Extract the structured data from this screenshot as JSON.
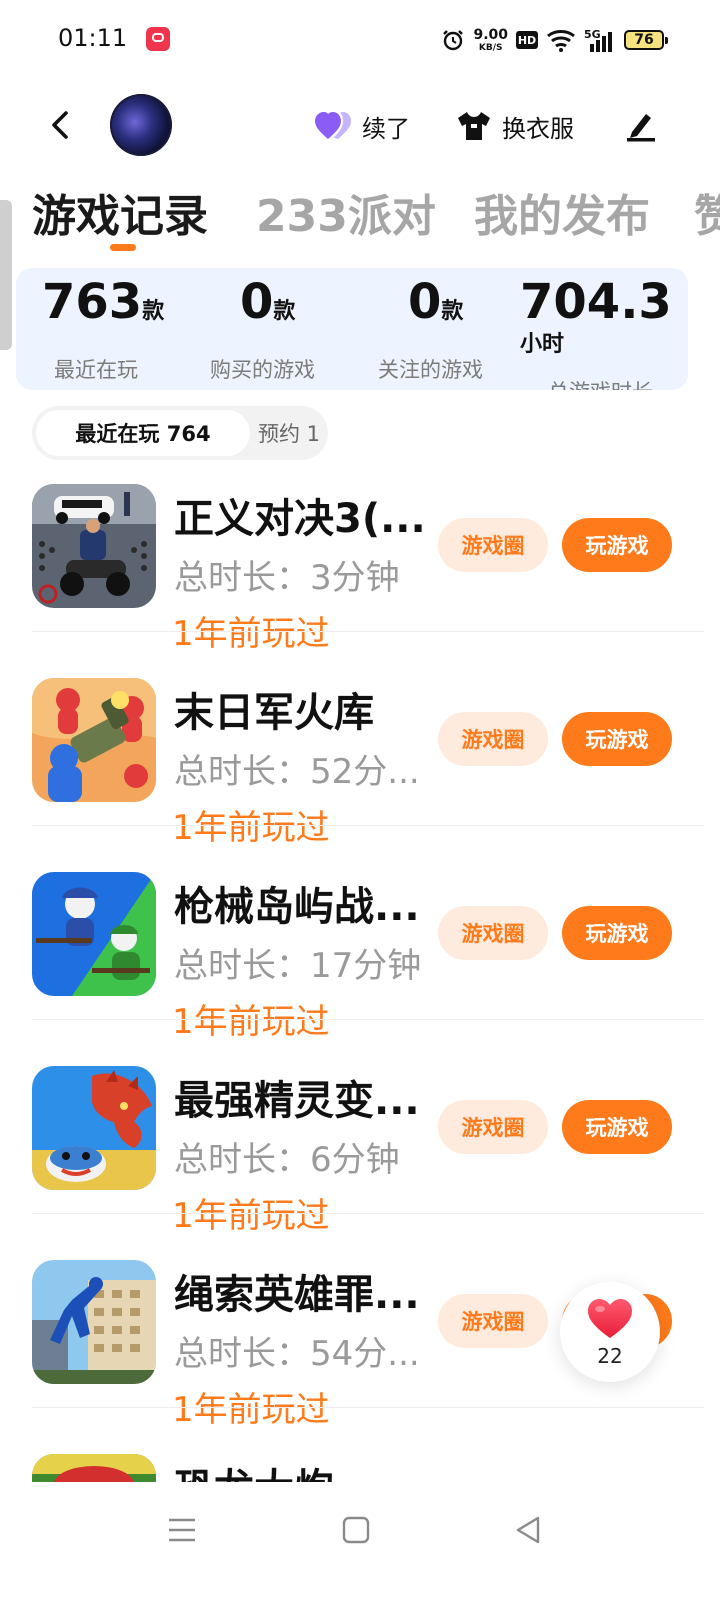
{
  "status_bar": {
    "time": "01:11",
    "net_speed": "9.00",
    "net_unit": "KB/S",
    "hd": "HD",
    "network": "5G",
    "battery": "76"
  },
  "header": {
    "xu_label": "续了",
    "clothes_label": "换衣服"
  },
  "tabs": [
    {
      "label": "游戏记录",
      "active": true
    },
    {
      "label": "233派对",
      "active": false
    },
    {
      "label": "我的发布",
      "active": false
    },
    {
      "label": "赞",
      "active": false
    }
  ],
  "stats": [
    {
      "value": "763",
      "unit": "款",
      "label": "最近在玩"
    },
    {
      "value": "0",
      "unit": "款",
      "label": "购买的游戏"
    },
    {
      "value": "0",
      "unit": "款",
      "label": "关注的游戏"
    },
    {
      "value": "704.3",
      "unit": "小时",
      "label": "总游戏时长"
    }
  ],
  "filters": {
    "recent": "最近在玩 764",
    "reserve": "预约 1"
  },
  "games": [
    {
      "title": "正义对决3(...",
      "duration": "总时长：3分钟",
      "last_played": "1年前玩过",
      "circle_label": "游戏圈",
      "play_label": "玩游戏",
      "icon": "police-game-icon"
    },
    {
      "title": "末日军火库",
      "duration": "总时长：52分...",
      "last_played": "1年前玩过",
      "circle_label": "游戏圈",
      "play_label": "玩游戏",
      "icon": "arsenal-game-icon"
    },
    {
      "title": "枪械岛屿战...",
      "duration": "总时长：17分钟",
      "last_played": "1年前玩过",
      "circle_label": "游戏圈",
      "play_label": "玩游戏",
      "icon": "gun-island-game-icon"
    },
    {
      "title": "最强精灵变...",
      "duration": "总时长：6分钟",
      "last_played": "1年前玩过",
      "circle_label": "游戏圈",
      "play_label": "玩游戏",
      "icon": "monster-evolve-game-icon"
    },
    {
      "title": "绳索英雄罪...",
      "duration": "总时长：54分...",
      "last_played": "1年前玩过",
      "circle_label": "游戏圈",
      "play_label": "玩游戏",
      "icon": "rope-hero-game-icon"
    },
    {
      "title": "恐龙大炮",
      "duration": "",
      "last_played": "",
      "circle_label": "",
      "play_label": "",
      "icon": "dino-game-icon"
    }
  ],
  "floating_like": {
    "count": "22"
  },
  "colors": {
    "accent": "#ff7a1a",
    "accent_light": "#ffebdd",
    "stats_bg": "#eef4ff"
  }
}
